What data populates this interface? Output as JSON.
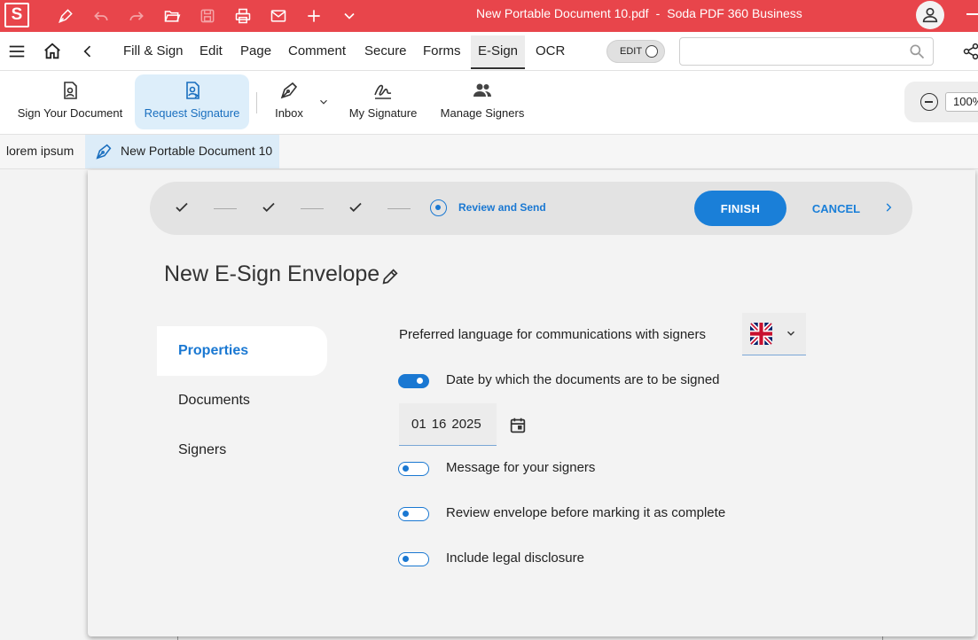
{
  "titlebar": {
    "app_logo": "S",
    "document_name": "New Portable Document 10.pdf",
    "separator": "-",
    "app_name": "Soda PDF 360 Business",
    "icons": [
      "pen-icon",
      "undo-icon",
      "redo-icon",
      "open-folder-icon",
      "save-icon",
      "print-icon",
      "mail-icon",
      "add-icon",
      "chevron-down-icon",
      "user-icon",
      "minimize-icon"
    ],
    "bg_color": "#e8454b"
  },
  "menubar": {
    "tabs": [
      "Fill & Sign",
      "Edit",
      "Page",
      "Comment",
      "Secure",
      "Forms",
      "E-Sign",
      "OCR"
    ],
    "active_tab": "E-Sign",
    "edit_toggle_label": "EDIT",
    "search_placeholder": ""
  },
  "ribbon": {
    "buttons": [
      {
        "label": "Sign Your Document",
        "icon": "document-sign-icon"
      },
      {
        "label": "Request Signature",
        "icon": "request-signature-icon",
        "active": true
      },
      {
        "label": "Inbox",
        "icon": "pen-nib-icon"
      },
      {
        "label": "My Signature",
        "icon": "signature-icon"
      },
      {
        "label": "Manage Signers",
        "icon": "people-icon"
      }
    ],
    "zoom": "100%"
  },
  "doc_tabs": {
    "items": [
      "lorem ipsum",
      "New Portable Document 10"
    ],
    "active": "New Portable Document 10"
  },
  "stepper": {
    "current_step_label": "Review and Send",
    "completed_steps": 3,
    "finish_label": "FINISH",
    "cancel_label": "CANCEL",
    "accent": "#1a7fd8"
  },
  "envelope": {
    "title": "New E-Sign Envelope"
  },
  "sidebar": {
    "items": [
      "Properties",
      "Documents",
      "Signers"
    ],
    "active": "Properties"
  },
  "properties": {
    "language_label": "Preferred language for communications with signers",
    "language_flag": "uk-flag-icon",
    "date_toggle_label": "Date by which the documents are to be signed",
    "date_toggle_on": true,
    "date": {
      "month": "01",
      "day": "16",
      "year": "2025"
    },
    "message_label": "Message for your signers",
    "message_on": false,
    "review_label": "Review envelope before marking it as complete",
    "review_on": false,
    "disclosure_label": "Include legal disclosure",
    "disclosure_on": false
  }
}
